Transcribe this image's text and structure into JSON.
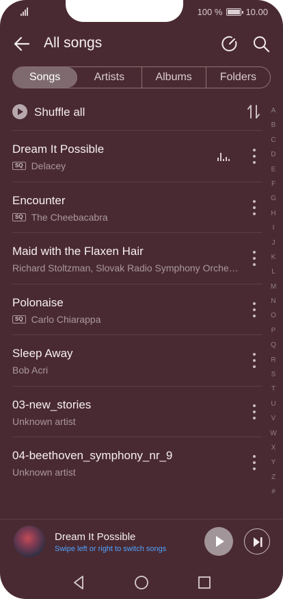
{
  "status_bar": {
    "battery": "100 %",
    "time": "10.00",
    "battery_level": 1.0
  },
  "header": {
    "title": "All songs"
  },
  "tabs": [
    {
      "label": "Songs",
      "active": true
    },
    {
      "label": "Artists",
      "active": false
    },
    {
      "label": "Albums",
      "active": false
    },
    {
      "label": "Folders",
      "active": false
    }
  ],
  "shuffle": {
    "label": "Shuffle all"
  },
  "songs": [
    {
      "title": "Dream It Possible",
      "artist": "Delacey",
      "sq": "SQ",
      "playing": true
    },
    {
      "title": "Encounter",
      "artist": "The Cheebacabra",
      "sq": "SQ",
      "playing": false
    },
    {
      "title": "Maid with the Flaxen Hair",
      "artist": "Richard Stoltzman, Slovak Radio Symphony Orche…",
      "sq": "",
      "playing": false
    },
    {
      "title": "Polonaise",
      "artist": "Carlo Chiarappa",
      "sq": "SQ",
      "playing": false
    },
    {
      "title": "Sleep Away",
      "artist": "Bob Acri",
      "sq": "",
      "playing": false
    },
    {
      "title": "03-new_stories",
      "artist": "Unknown artist",
      "sq": "",
      "playing": false
    },
    {
      "title": "04-beethoven_symphony_nr_9",
      "artist": "Unknown artist",
      "sq": "",
      "playing": false
    }
  ],
  "alphabet_index": [
    "A",
    "B",
    "C",
    "D",
    "E",
    "F",
    "G",
    "H",
    "I",
    "J",
    "K",
    "L",
    "M",
    "N",
    "O",
    "P",
    "Q",
    "R",
    "S",
    "T",
    "U",
    "V",
    "W",
    "X",
    "Y",
    "Z",
    "#"
  ],
  "mini_player": {
    "title": "Dream It Possible",
    "hint": "Swipe left or right to switch songs"
  },
  "colors": {
    "background": "#4a2a32",
    "accent": "#4da3ff"
  }
}
